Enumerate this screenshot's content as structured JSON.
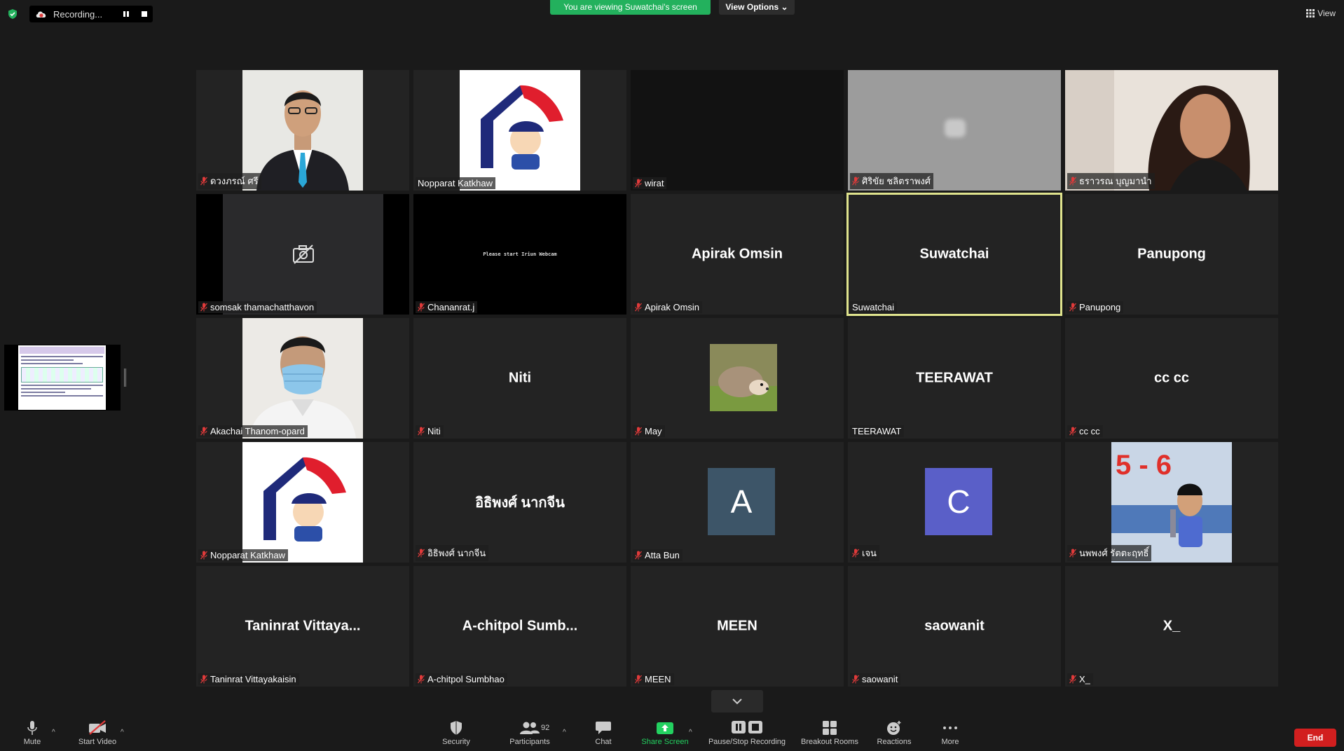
{
  "colors": {
    "accent_green": "#23b15d",
    "end_red": "#d21f1f",
    "active_border": "#dfe38d",
    "mic_off_red": "#e03a3a"
  },
  "topbar": {
    "recording_label": "Recording...",
    "viewing_banner": "You are viewing Suwatchai's screen",
    "view_options": "View Options",
    "view_label": "View"
  },
  "tiles": [
    {
      "name": "ดวงภรณ์ ศรี",
      "muted": true,
      "kind": "photo-man-suit"
    },
    {
      "name": "Nopparat Katkhaw",
      "muted": false,
      "kind": "logo"
    },
    {
      "name": "wirat",
      "muted": true,
      "kind": "dark"
    },
    {
      "name": "ศิริขัย ชลิตราพงศ์",
      "muted": true,
      "kind": "gray"
    },
    {
      "name": "ธราวรณ บุญมานำ",
      "muted": true,
      "kind": "photo-girl"
    },
    {
      "name": "somsak thamachatthavon",
      "muted": true,
      "kind": "camoff"
    },
    {
      "name": "Chananrat.j",
      "muted": true,
      "kind": "black-text",
      "center_text": "Please start Iriun Webcam"
    },
    {
      "name": "Apirak Omsin",
      "muted": true,
      "kind": "name",
      "center_text": "Apirak Omsin"
    },
    {
      "name": "Suwatchai",
      "muted": false,
      "kind": "name",
      "center_text": "Suwatchai",
      "active": true
    },
    {
      "name": "Panupong",
      "muted": true,
      "kind": "name",
      "center_text": "Panupong"
    },
    {
      "name": "Akachai Thanom-opard",
      "muted": true,
      "kind": "photo-mask"
    },
    {
      "name": "Niti",
      "muted": true,
      "kind": "name",
      "center_text": "Niti"
    },
    {
      "name": "May",
      "muted": true,
      "kind": "hedgehog"
    },
    {
      "name": "TEERAWAT",
      "muted": false,
      "kind": "name",
      "center_text": "TEERAWAT"
    },
    {
      "name": "cc cc",
      "muted": true,
      "kind": "name",
      "center_text": "cc cc"
    },
    {
      "name": "Nopparat Katkhaw",
      "muted": true,
      "kind": "logo"
    },
    {
      "name": "อิธิพงศ์ นากจีน",
      "muted": true,
      "kind": "name",
      "center_text": "อิธิพงศ์ นากจีน"
    },
    {
      "name": "Atta Bun",
      "muted": true,
      "kind": "letter",
      "letter": "A",
      "letter_color": "#3d5568"
    },
    {
      "name": "เจน",
      "muted": true,
      "kind": "letter",
      "letter": "C",
      "letter_color": "#5a5fc8"
    },
    {
      "name": "นพพงศ์ รัตตะฤทธิ์",
      "muted": true,
      "kind": "photo-kid"
    },
    {
      "name": "Taninrat Vittayakaisin",
      "muted": true,
      "kind": "name",
      "center_text": "Taninrat  Vittaya..."
    },
    {
      "name": "A-chitpol Sumbhao",
      "muted": true,
      "kind": "name",
      "center_text": "A-chitpol  Sumb..."
    },
    {
      "name": "MEEN",
      "muted": true,
      "kind": "name",
      "center_text": "MEEN"
    },
    {
      "name": "saowanit",
      "muted": true,
      "kind": "name",
      "center_text": "saowanit"
    },
    {
      "name": "X_",
      "muted": true,
      "kind": "name",
      "center_text": "X_"
    }
  ],
  "toolbar": {
    "mute": "Mute",
    "start_video": "Start Video",
    "security": "Security",
    "participants": "Participants",
    "participant_count": "92",
    "chat": "Chat",
    "share_screen": "Share Screen",
    "pause_stop_recording": "Pause/Stop Recording",
    "breakout_rooms": "Breakout Rooms",
    "reactions": "Reactions",
    "more": "More",
    "end": "End"
  }
}
